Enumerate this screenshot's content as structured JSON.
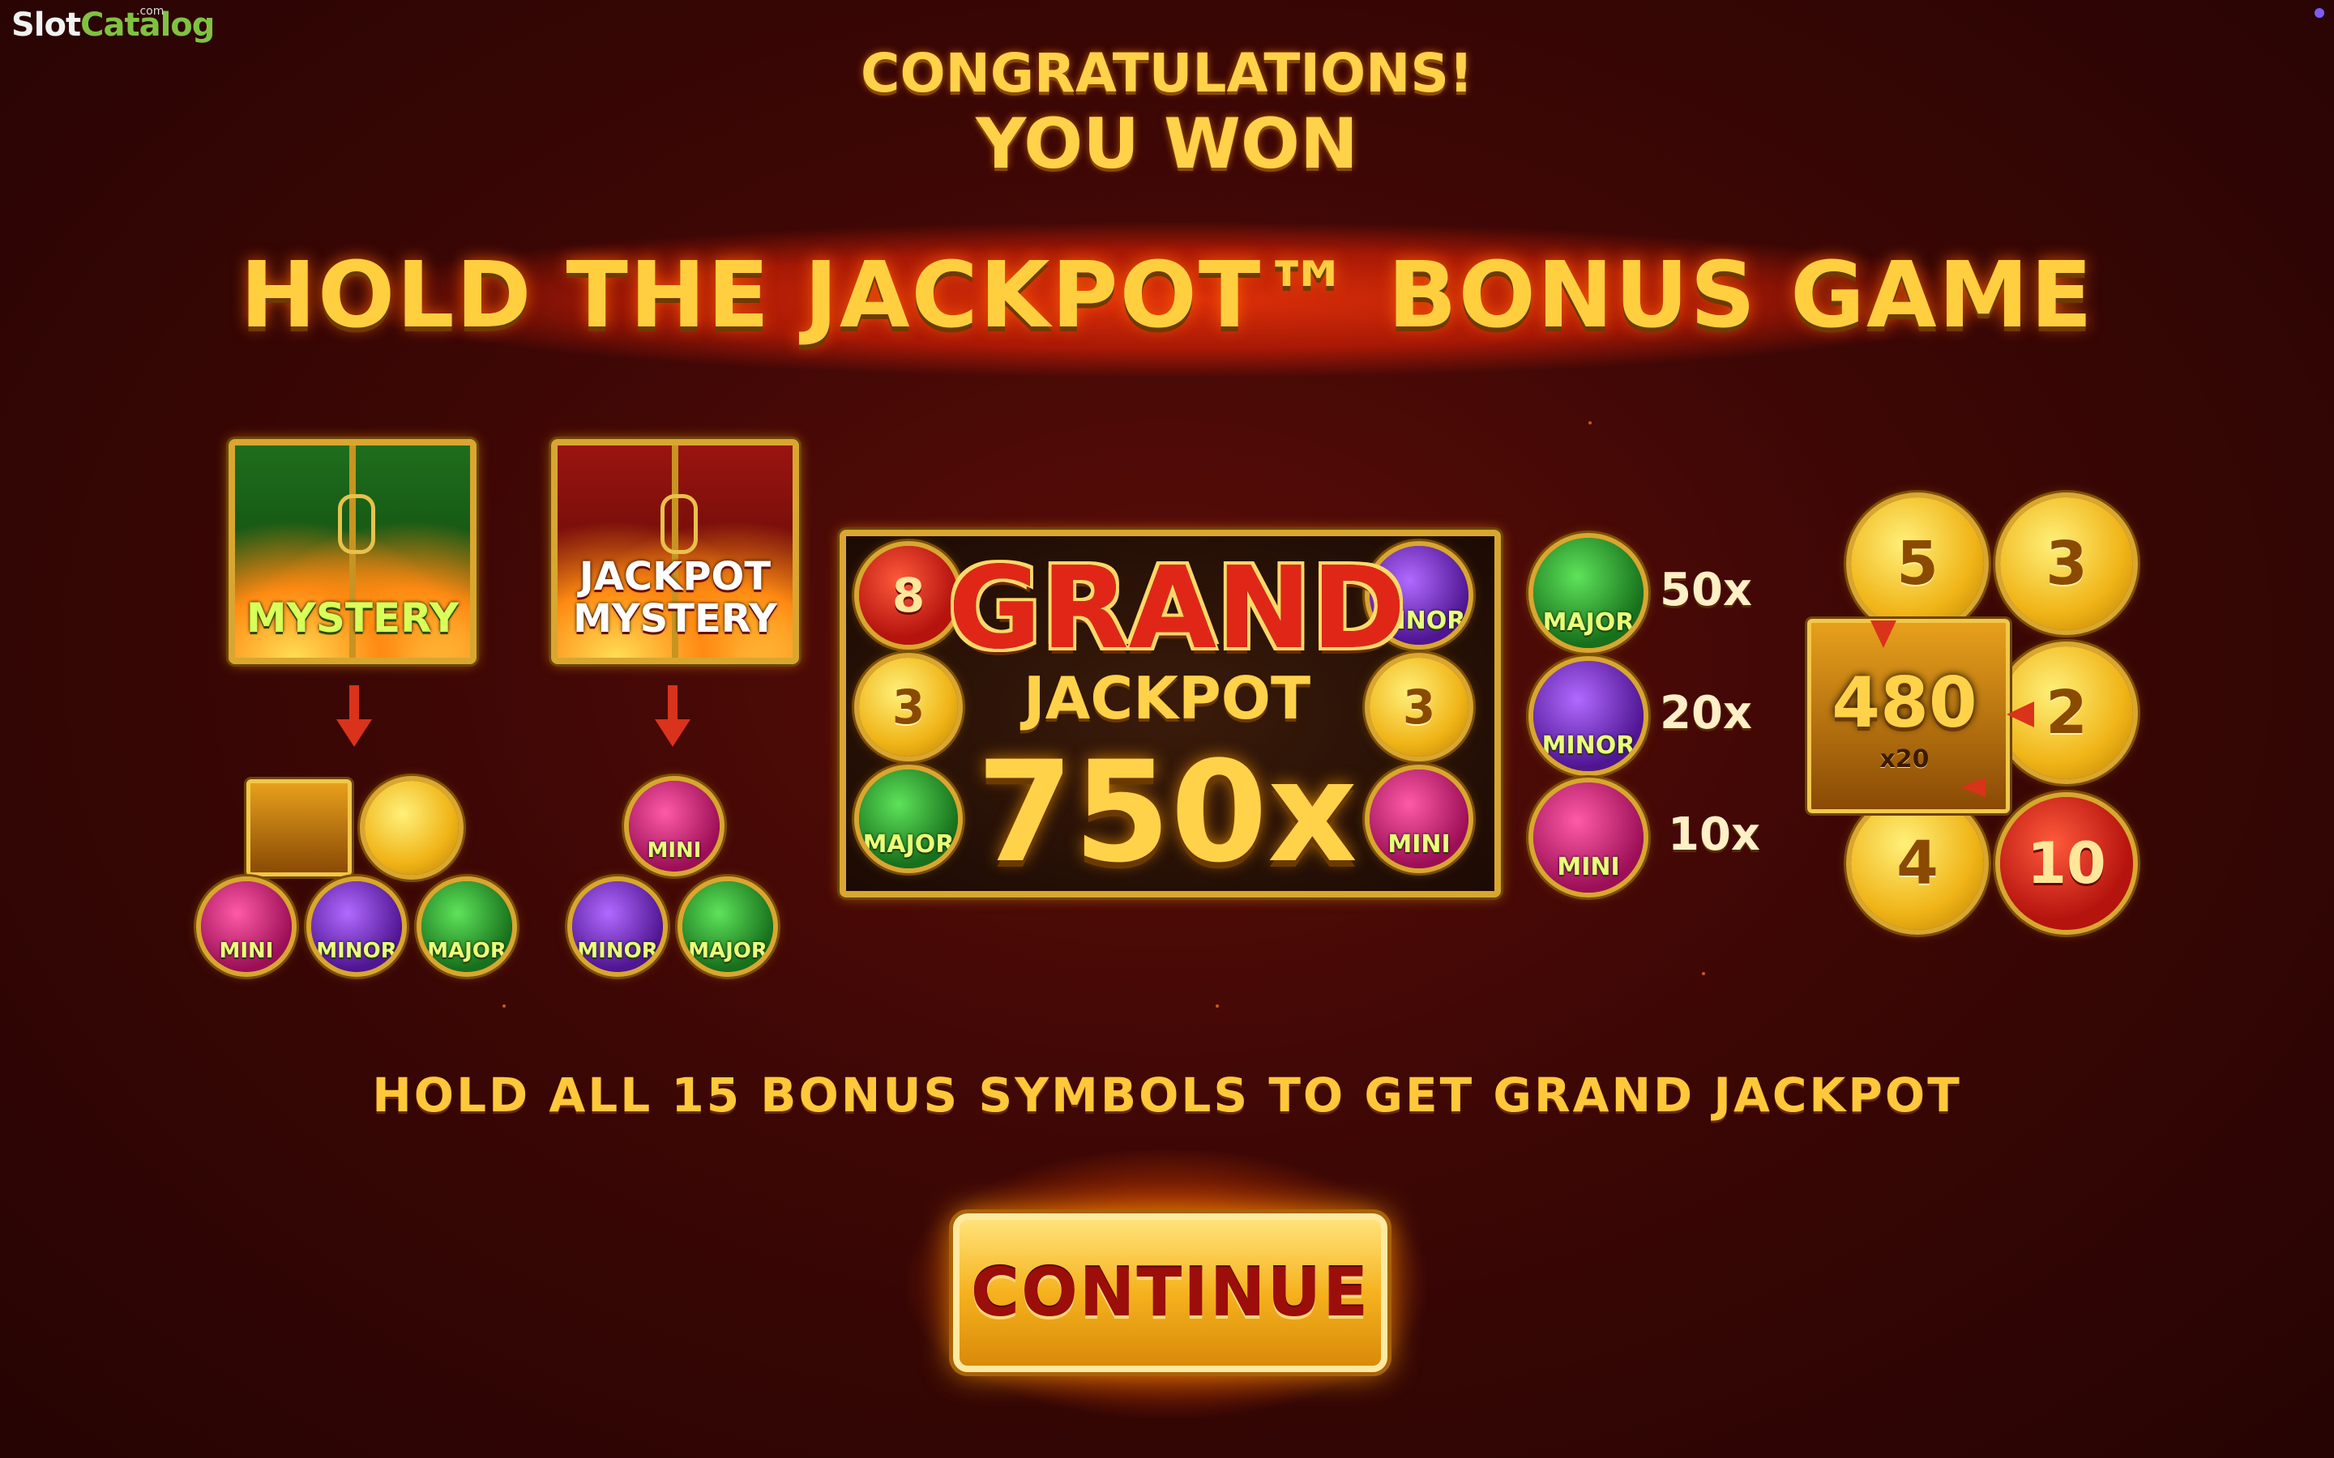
{
  "brand": {
    "name_part1": "Slot",
    "name_part2": "Catalog",
    "suffix": ".com"
  },
  "header": {
    "congrats": "CONGRATULATIONS!",
    "you_won": "YOU WON"
  },
  "banner": {
    "title": "HOLD THE JACKPOT™ BONUS GAME"
  },
  "mystery": {
    "label": "MYSTERY",
    "results": [
      "MINI",
      "MINOR",
      "MAJOR"
    ]
  },
  "jackpot_mystery": {
    "label_line1": "JACKPOT",
    "label_line2": "MYSTERY",
    "results": [
      "MINI",
      "MINOR",
      "MAJOR"
    ]
  },
  "grand_panel": {
    "grand": "GRAND",
    "jackpot": "JACKPOT",
    "multiplier": "750x",
    "coins": [
      "8",
      "3",
      "3",
      "MAJOR",
      "MINI",
      "MINOR"
    ]
  },
  "jackpots": [
    {
      "name": "MAJOR",
      "multiplier": "50x"
    },
    {
      "name": "MINOR",
      "multiplier": "20x"
    },
    {
      "name": "MINI",
      "multiplier": "10x"
    }
  ],
  "collect": {
    "coins": [
      "5",
      "3",
      "2",
      "4",
      "10"
    ],
    "total": "480",
    "multiplier": "x20"
  },
  "footer": {
    "hold_text": "HOLD ALL 15 BONUS SYMBOLS TO GET GRAND JACKPOT"
  },
  "continue_button": {
    "label": "CONTINUE"
  },
  "colors": {
    "gold": "#ffd24a",
    "red": "#d9331b",
    "bg": "#3d0705"
  }
}
